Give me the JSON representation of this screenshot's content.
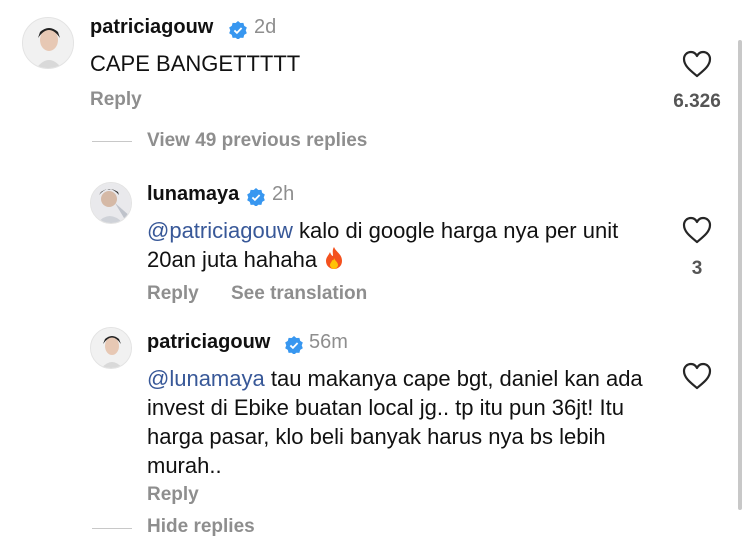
{
  "comments": [
    {
      "username": "patriciagouw",
      "time": "2d",
      "text_plain": "CAPE BANGETTTTT",
      "reply_label": "Reply",
      "like_count": "6.326"
    },
    {
      "username": "lunamaya",
      "time": "2h",
      "mention": "@patriciagouw",
      "text": " kalo di google harga nya per unit 20an juta hahaha ",
      "emoji": "fire",
      "reply_label": "Reply",
      "translate_label": "See translation",
      "like_count": "3"
    },
    {
      "username": "patriciagouw",
      "time": "56m",
      "mention": "@lunamaya",
      "text": " tau makanya cape bgt, daniel kan ada invest di Ebike buatan local jg.. tp itu pun 36jt! Itu harga pasar, klo beli banyak harus nya bs lebih murah..",
      "reply_label": "Reply"
    }
  ],
  "thread": {
    "view_previous_label": "View 49 previous replies",
    "hide_replies_label": "Hide replies"
  },
  "colors": {
    "verified": "#3897f0",
    "mention": "#385898",
    "secondary_text": "#8e8e8e"
  }
}
